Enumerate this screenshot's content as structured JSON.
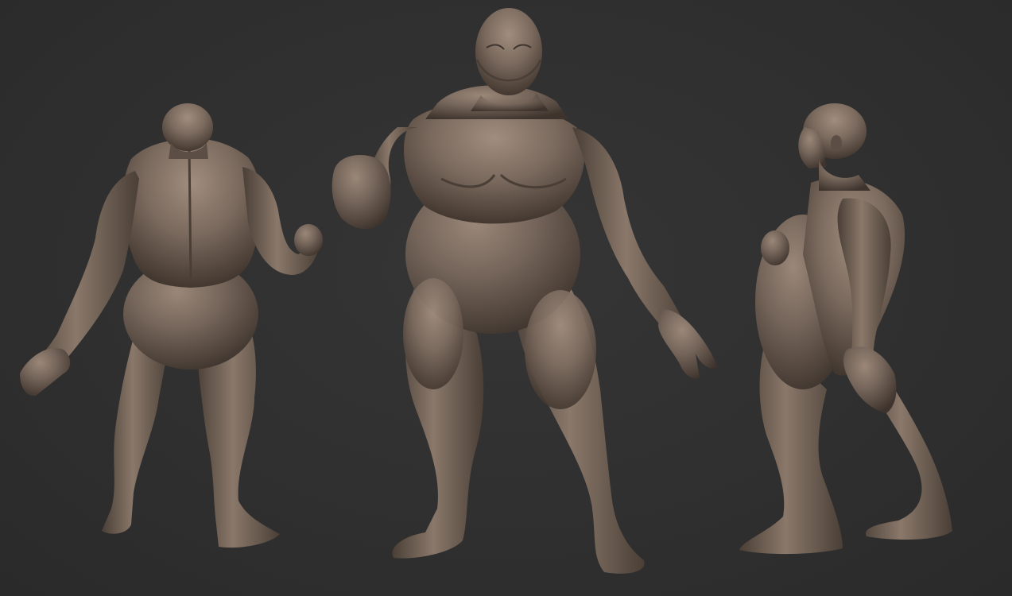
{
  "scene": {
    "background_color": "#303030",
    "material_color": "#6e5e52",
    "highlight_color": "#9a8778",
    "shadow_color": "#3e342d",
    "views": [
      {
        "name": "back-view",
        "orientation": "back"
      },
      {
        "name": "front-view",
        "orientation": "front"
      },
      {
        "name": "side-view",
        "orientation": "right-side"
      }
    ]
  }
}
